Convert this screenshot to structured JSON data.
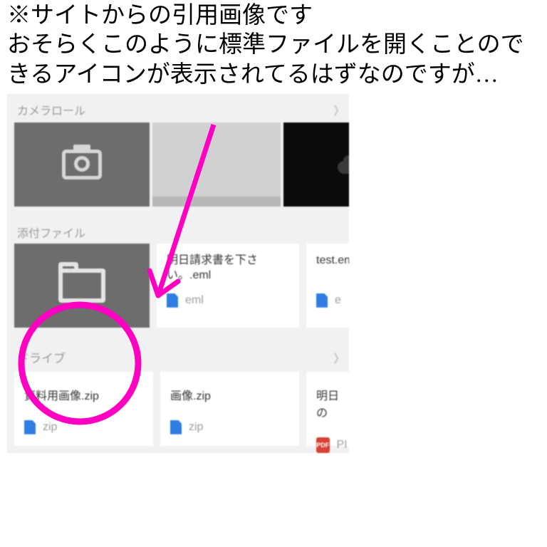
{
  "caption": {
    "l1": "※サイトからの引用画像です",
    "l2": "おそらくこのように標準ファイルを開くことのできるアイコンが表示されてるはずなのですが…"
  },
  "sections": {
    "camera": "カメラロール",
    "attach": "添付ファイル",
    "drive": "ドライブ"
  },
  "attachFiles": [
    {
      "title": "明日請求書を下さい。.eml",
      "ext": "eml",
      "kind": "doc"
    },
    {
      "title": "test.eml",
      "ext": "eml",
      "kind": "doc"
    }
  ],
  "driveFiles": [
    {
      "title": "資料用画像.zip",
      "ext": "zip",
      "kind": "doc"
    },
    {
      "title": "画像.zip",
      "ext": "zip",
      "kind": "doc"
    },
    {
      "title": "明日の",
      "ext": "PDF",
      "kind": "pdf"
    }
  ],
  "annotation": {
    "circleColor": "#ff00c3",
    "arrowColor": "#ff00c3"
  }
}
